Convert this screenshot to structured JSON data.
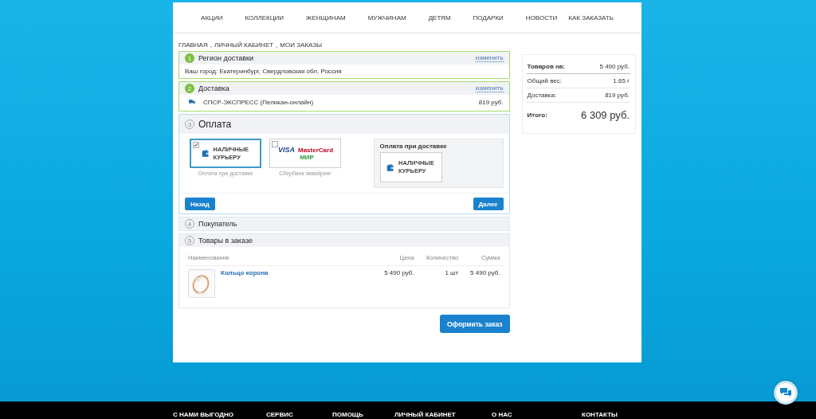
{
  "nav": [
    "АКЦИИ",
    "КОЛЛЕКЦИИ",
    "ЖЕНЩИНАМ",
    "МУЖЧИНАМ",
    "ДЕТЯМ",
    "ПОДАРКИ",
    "НОВОСТИ",
    "КАК ЗАКАЗАТЬ"
  ],
  "breadcrumb": {
    "separator": ",",
    "items": [
      "ГЛАВНАЯ",
      "ЛИЧНЫЙ КАБИНЕТ",
      "МОИ ЗАКАЗЫ"
    ]
  },
  "steps": [
    {
      "number": "1",
      "title": "Регион доставки",
      "done": true,
      "active": false,
      "change_link": "изменить",
      "kind": "text",
      "text": "Ваш город: Екатеринбург, Свердловская обл, Россия"
    },
    {
      "number": "2",
      "title": "Доставка",
      "done": true,
      "active": false,
      "change_link": "изменить",
      "kind": "delivery",
      "service": "СПСР-ЭКСПРЕСС (Пеликан-онлайн)",
      "price": "819 руб."
    },
    {
      "number": "3",
      "title": "Оплата",
      "done": false,
      "active": true,
      "kind": "payment",
      "options": [
        {
          "kind": "cash",
          "label": "НАЛИЧНЫЕ КУРЬЕРУ",
          "caption": "Оплата при доставке",
          "selected": true
        },
        {
          "kind": "cards",
          "logos": [
            "VISA",
            "MasterCard",
            "МИР"
          ],
          "caption": "Сбербанк эквайринг",
          "selected": false
        }
      ],
      "selected_panel": {
        "title": "Оплата при доставке",
        "label": "НАЛИЧНЫЕ КУРЬЕРУ"
      },
      "buttons": {
        "back": "Назад",
        "next": "Далее"
      }
    },
    {
      "number": "4",
      "title": "Покупатель",
      "done": false,
      "active": false,
      "kind": "none"
    },
    {
      "number": "5",
      "title": "Товары в заказе",
      "done": false,
      "active": false,
      "kind": "goods",
      "columns": [
        "Наименование",
        "Цена",
        "Количество",
        "Сумма"
      ],
      "rows": [
        {
          "name": "Кольцо корона",
          "price": "5 490 руб.",
          "quantity": "1 шт",
          "sum": "5 490 руб."
        }
      ]
    }
  ],
  "order_button": "Оформить заказ",
  "summary": {
    "rows": [
      {
        "label": "Товаров на:",
        "value": "5 490 руб.",
        "bold": true
      },
      {
        "label": "Общий вес:",
        "value": "1.65 г",
        "bold": false
      },
      {
        "label": "Доставка:",
        "value": "819 руб.",
        "bold": false
      }
    ],
    "total": {
      "label": "Итого:",
      "value": "6 309 руб."
    }
  },
  "footer": [
    "С НАМИ ВЫГОДНО",
    "СЕРВИС",
    "ПОМОЩЬ",
    "ЛИЧНЫЙ КАБИНЕТ",
    "О НАС",
    "КОНТАКТЫ"
  ]
}
